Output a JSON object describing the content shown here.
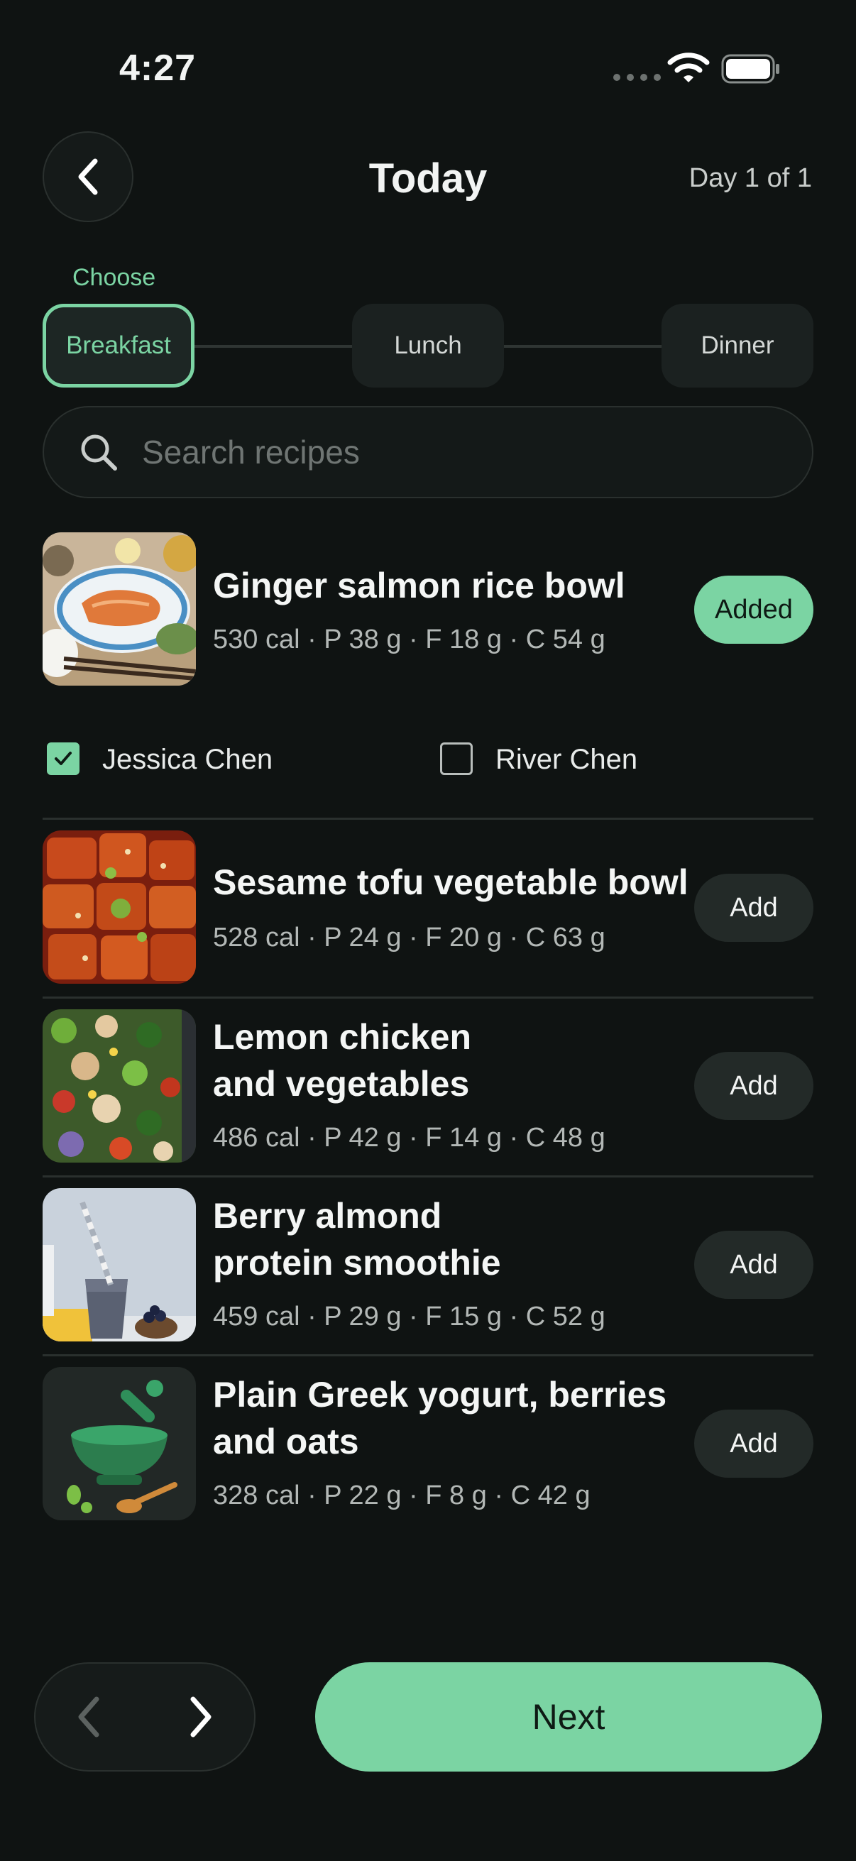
{
  "status_bar": {
    "time": "4:27"
  },
  "header": {
    "title": "Today",
    "day_label": "Day 1 of 1"
  },
  "meal_picker": {
    "hint": "Choose",
    "tabs": [
      {
        "label": "Breakfast",
        "active": true
      },
      {
        "label": "Lunch",
        "active": false
      },
      {
        "label": "Dinner",
        "active": false
      }
    ]
  },
  "search": {
    "placeholder": "Search recipes",
    "value": ""
  },
  "recipes": [
    {
      "name": "Ginger salmon rice bowl",
      "macros": "530 cal · P 38 g · F 18 g · C 54 g",
      "action": "Added",
      "image": "salmon-bowl-photo"
    },
    {
      "name": "Sesame tofu vegetable bowl",
      "macros": "528 cal · P 24 g · F 20 g · C 63 g",
      "action": "Add",
      "image": "tofu-photo"
    },
    {
      "name_line1": "Lemon chicken",
      "name_line2": "and vegetables",
      "macros": "486 cal · P 42 g · F 14 g · C 48 g",
      "action": "Add",
      "image": "chicken-vegetables-photo"
    },
    {
      "name_line1": "Berry almond",
      "name_line2": "protein smoothie",
      "macros": "459 cal · P 29 g · F 15 g · C 52 g",
      "action": "Add",
      "image": "smoothie-photo"
    },
    {
      "name_line1": "Plain Greek yogurt, berries",
      "name_line2": "and oats",
      "macros": "328 cal · P 22 g · F 8 g · C 42 g",
      "action": "Add",
      "image": "mortar-pestle-icon"
    }
  ],
  "people": [
    {
      "name": "Jessica Chen",
      "checked": true
    },
    {
      "name": "River Chen",
      "checked": false
    }
  ],
  "footer": {
    "next_label": "Next"
  },
  "colors": {
    "accent": "#7bd4a3",
    "background": "#0f1312"
  }
}
